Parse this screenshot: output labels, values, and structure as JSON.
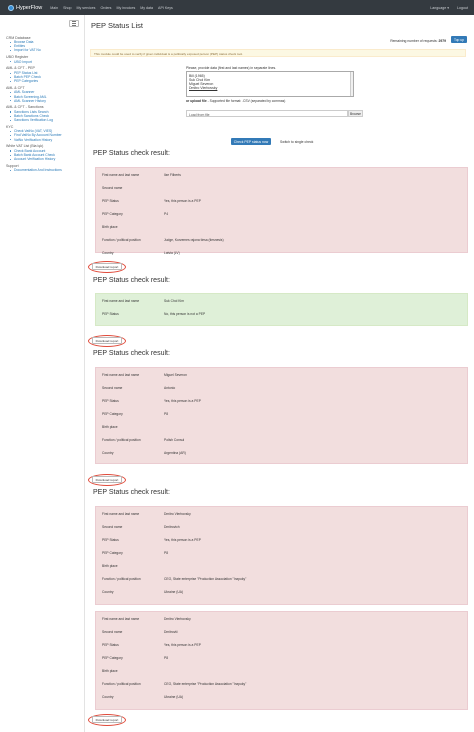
{
  "nav": {
    "brand": "HyperFlow",
    "links": [
      "Main",
      "Shop",
      "My services",
      "Orders",
      "My invoices",
      "My data",
      "API Keys"
    ],
    "language": "Language ▾",
    "logout": "Logout"
  },
  "sidebar": {
    "sections": [
      {
        "title": "CRM Database",
        "items": [
          "Browse Data",
          "Entities",
          "Import for VAT No"
        ]
      },
      {
        "title": "UBO Register",
        "items": [
          "UBO Import"
        ]
      },
      {
        "title": "AML & CFT - PEP",
        "items": [
          "PEP Status List",
          "Batch PEP Check",
          "PEP Categories"
        ]
      },
      {
        "title": "AML & CFT",
        "items": [
          "AML Scanner",
          "Batch Screening AML",
          "AML Scanner History"
        ]
      },
      {
        "title": "AML & CFT - Sanctions",
        "items": [
          "Sanctions Lists Search",
          "Batch Sanctions Check",
          "Sanctions Verification Log"
        ]
      },
      {
        "title": "KYC",
        "items": [
          "Check VatNo (VAT, VIES)",
          "Find VatNo By Account Number",
          "VatNo Verification History"
        ]
      },
      {
        "title": "White VAT List (Bia lęk)",
        "items": [
          "Check Bank Account",
          "Batch Bank Account Check",
          "Account Verification History"
        ]
      },
      {
        "title": "Support",
        "items": [
          "Documentation And Instructions"
        ]
      }
    ]
  },
  "page": {
    "title": "PEP Status List",
    "remaining_label": "Remaining number of requests:",
    "remaining_value": "2979",
    "topup": "Top up",
    "warning": "This module could be used to verify if given individual is a politically exposed person (PEP) status check tool.",
    "instructions": "Please, provide data (first and last names) in separate lines.",
    "names": [
      "Bill (1965)",
      "Suk Chol Kim",
      "Miguel Severon",
      "Dmitro Vlerbovsky"
    ],
    "upload_prefix": "or upload file",
    "upload_hint": "- Supported file format: .CSV (separated by commas)",
    "file_placeholder": "Load from file",
    "browse": "Browse",
    "check_button": "Check PEP status now",
    "switch_link": "Switch to single check",
    "result_heading": "PEP Status check result:",
    "download": "Download report"
  },
  "field_labels": {
    "name": "First name and last name",
    "second": "Second name",
    "status": "PEP Status",
    "category": "PEP Category",
    "birth": "Birth place",
    "function": "Function / political position",
    "country": "Country"
  },
  "results": [
    {
      "status": "pep",
      "name": "Ilze Filberts",
      "second": "",
      "pep_status": "Yes, this person is a PEP",
      "category": "P4",
      "birth": "",
      "function": "Judge, Kurzemes rajona tiesa (tiesnesis)",
      "country": "Latvia (LV)"
    },
    {
      "status": "nopep",
      "name": "Suk Chol Kim",
      "pep_status": "No, this person is not a PEP"
    },
    {
      "status": "pep",
      "name": "Miguel Severon",
      "second": "Antonio",
      "pep_status": "Yes, this person is a PEP",
      "category": "P8",
      "birth": "",
      "function": "Polish Consul",
      "country": "Argentina (AR)"
    },
    {
      "status": "pep",
      "name": "Dmitro Vlerbovsky",
      "second": "Dmitrovich",
      "pep_status": "Yes, this person is a PEP",
      "category": "P8",
      "birth": "",
      "function": "CEO, State enterprise \"Production Association \"Inzpuky\"",
      "country": "Ukraine (UA)"
    },
    {
      "status": "pep",
      "name": "Dmitro Vlerbovsky",
      "second": "Dmitrovič",
      "pep_status": "Yes, this person is a PEP",
      "category": "P8",
      "birth": "",
      "function": "CEO, State enterprise \"Production Association \"Inzpuky\"",
      "country": "Ukraine (UA)"
    }
  ]
}
